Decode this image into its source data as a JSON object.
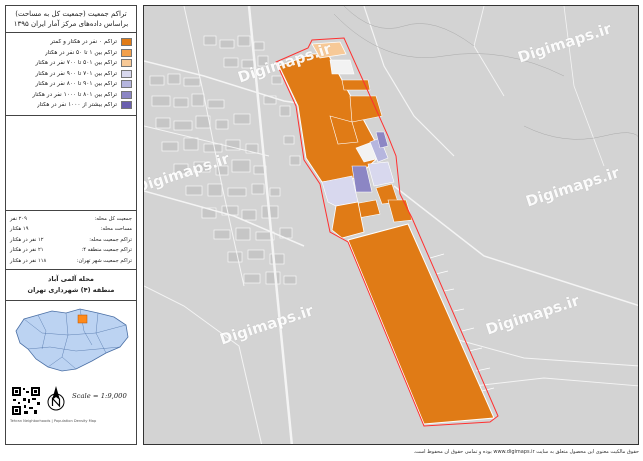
{
  "title": {
    "line1": "تراکم جمعیت (جمعیت کل به مساحت)",
    "line2": "براساس داده‌های مرکز آمار ایران ۱۳۹۵"
  },
  "legend": [
    {
      "label": "تراکم ۰ نفر در هکتار و کمتر",
      "color": "#e07b16"
    },
    {
      "label": "تراکم بین ۱ تا ۵۰ نفر در هکتار",
      "color": "#f2a04c"
    },
    {
      "label": "تراکم بین ۵۰۱ تا ۷۰۰ نفر در هکتار",
      "color": "#f7c997"
    },
    {
      "label": "تراکم بین ۷۰۱ تا ۹۰۰ نفر در هکتار",
      "color": "#d8d8ee"
    },
    {
      "label": "تراکم بین ۹۰۱ تا ۸۰۰ نفر در هکتار",
      "color": "#b6b6de"
    },
    {
      "label": "تراکم بین ۸۰۱ تا ۱۰۰۰ نفر در هکتار",
      "color": "#8c86c4"
    },
    {
      "label": "تراکم بیشتر از ۱۰۰۰ نفر در هکتار",
      "color": "#6a5fae"
    }
  ],
  "stats": [
    {
      "key": "جمعیت کل محله:",
      "value": "۲۰۹ نفر"
    },
    {
      "key": "مساحت محله:",
      "value": "۱۹ هکتار"
    },
    {
      "key": "تراکم جمعیت محله:",
      "value": "۱۲ نفر در هکتار"
    },
    {
      "key": "تراکم جمعیت منطقه ۴:",
      "value": "۲۱ نفر در هکتار"
    },
    {
      "key": "تراکم جمعیت شهر تهران:",
      "value": "۱۱۸ نفر در هکتار"
    }
  ],
  "place": {
    "line1": "محله آلمی آباد",
    "line2": "منطقه (۴) شهرداری تهران"
  },
  "scale": "Scale = 1:9,000",
  "credit": "Tehran Neighborhoods | Population Density Map",
  "watermark": "Digimaps.ir",
  "footer": "حقوق مالکیت معنوی این محصول متعلق به سایت www.digimaps.ir بوده و تمامی حقوق آن محفوظ است.",
  "colors": {
    "background": "#d3d3d3",
    "block": "#e07b16",
    "boundary": "#ff3030",
    "road": "#f2f2f2"
  }
}
